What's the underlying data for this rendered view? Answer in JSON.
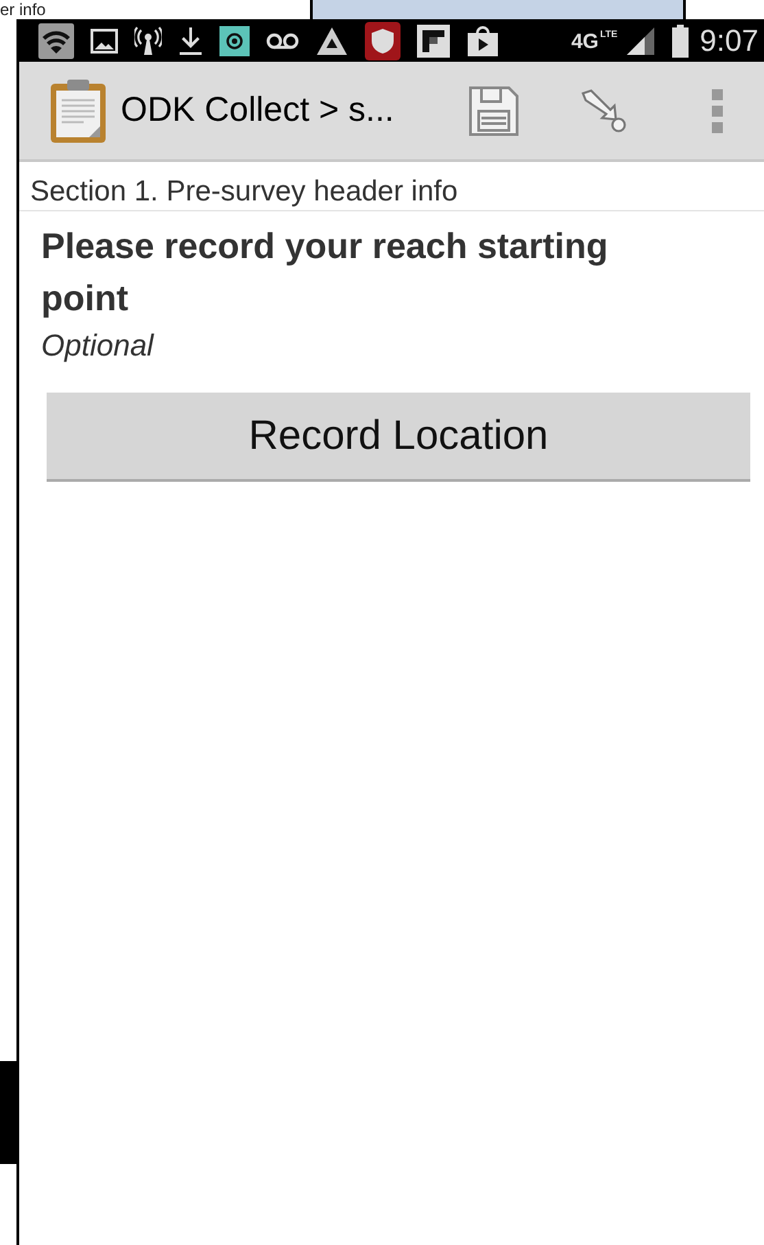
{
  "background": {
    "fragment_text": "er info"
  },
  "status_bar": {
    "network": "4G",
    "network_sub": "LTE",
    "time": "9:07"
  },
  "action_bar": {
    "title": "ODK Collect > s..."
  },
  "section_title": "Section 1. Pre-survey header info",
  "question": {
    "label": "Please record your reach starting point",
    "hint": "Optional",
    "button": "Record Location"
  }
}
